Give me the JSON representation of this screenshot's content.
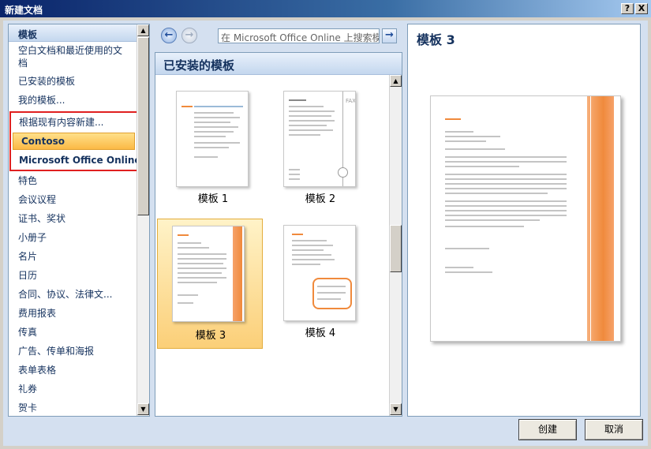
{
  "window": {
    "title": "新建文档",
    "help_label": "?",
    "close_label": "X"
  },
  "left_panel": {
    "header": "模板",
    "items": [
      "空白文档和最近使用的文档",
      "已安装的模板",
      "我的模板..."
    ],
    "boxed_items": [
      "根据现有内容新建...",
      "Contoso",
      "Microsoft Office Online"
    ],
    "online_categories": [
      "特色",
      "会议议程",
      "证书、奖状",
      "小册子",
      "名片",
      "日历",
      "合同、协议、法律文...",
      "费用报表",
      "传真",
      "广告、传单和海报",
      "表单表格",
      "礼券",
      "贺卡"
    ]
  },
  "navigation": {
    "back_icon": "left-arrow-icon",
    "forward_icon": "right-arrow-icon",
    "search_placeholder": "在 Microsoft Office Online 上搜索模板",
    "go_icon": "go-arrow-icon"
  },
  "middle_panel": {
    "header": "已安装的模板",
    "templates": [
      {
        "name": "模板 1",
        "selected": false
      },
      {
        "name": "模板 2",
        "selected": false
      },
      {
        "name": "模板 3",
        "selected": true
      },
      {
        "name": "模板 4",
        "selected": false
      }
    ]
  },
  "preview_panel": {
    "title": "模板 3"
  },
  "buttons": {
    "create": "创建",
    "cancel": "取消"
  },
  "colors": {
    "accent_orange": "#f08a3c",
    "highlight_red": "#e02020",
    "selection": "#fbcf78",
    "heading_blue": "#15325e"
  }
}
